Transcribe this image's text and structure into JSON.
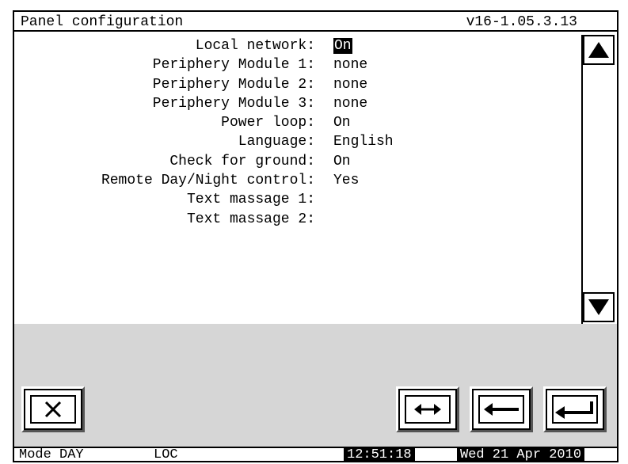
{
  "header": {
    "title": "Panel configuration",
    "version": "v16-1.05.3.13"
  },
  "settings": [
    {
      "label": "Local network:",
      "value": "On",
      "selected": true
    },
    {
      "label": "Periphery Module 1:",
      "value": "none"
    },
    {
      "label": "Periphery Module 2:",
      "value": "none"
    },
    {
      "label": "Periphery Module 3:",
      "value": "none"
    },
    {
      "label": "Power loop:",
      "value": "On"
    },
    {
      "label": "Language:",
      "value": "English"
    },
    {
      "label": "Check for ground:",
      "value": "On"
    },
    {
      "label": "Remote Day/Night control:",
      "value": "Yes"
    },
    {
      "label": "Text massage 1:",
      "value": ""
    },
    {
      "label": "Text massage 2:",
      "value": ""
    }
  ],
  "scrollbar": {
    "up_icon": "triangle-up-icon",
    "down_icon": "triangle-down-icon"
  },
  "toolbar": {
    "cancel_icon": "close-icon",
    "switch_icon": "left-right-arrow-icon",
    "back_icon": "left-arrow-icon",
    "enter_icon": "enter-return-icon"
  },
  "status": {
    "mode": "Mode DAY",
    "network": "LOC",
    "time": "12:51:18",
    "date": "Wed 21 Apr 2010"
  }
}
